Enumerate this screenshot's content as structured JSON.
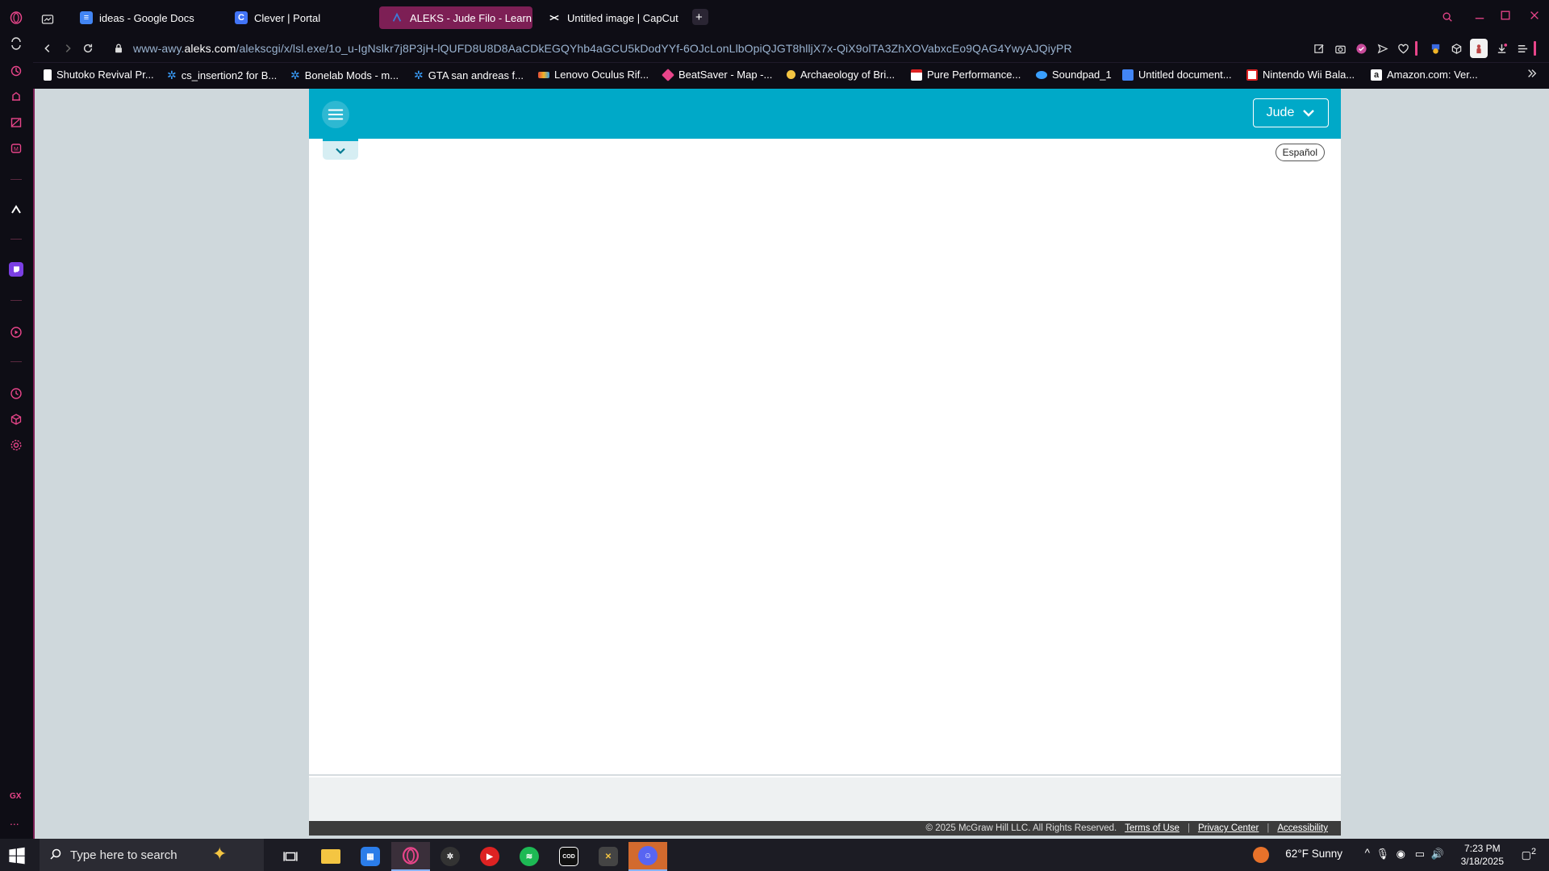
{
  "browser": {
    "tabs": [
      {
        "title": "ideas - Google Docs",
        "icon": "google-docs-icon",
        "color": "#4285f4",
        "active": false
      },
      {
        "title": "Clever | Portal",
        "icon": "clever-icon",
        "color": "#4274f6",
        "active": false
      },
      {
        "title": "ALEKS - Jude Filo - Learn",
        "icon": "aleks-icon",
        "color": "#8c2b6c",
        "active": true
      },
      {
        "title": "Untitled image | CapCut",
        "icon": "capcut-icon",
        "color": "#ffffff",
        "active": false
      }
    ],
    "new_tab": "+",
    "url_prefix": "www-awy.",
    "url_host": "aleks.com",
    "url_path": "/alekscgi/x/lsl.exe/1o_u-IgNslkr7j8P3jH-lQUFD8U8D8AaCDkEGQYhb4aGCU5kDodYYf-6OJcLonLlbOpiQJGT8hlljX7x-QiX9olTA3ZhXOVabxcEo9QAG4YwyAJQiyPR",
    "bookmarks": [
      {
        "label": "Shutoko Revival Pr...",
        "color": "#ffffff"
      },
      {
        "label": "cs_insertion2 for B...",
        "color": "#3aa0ff"
      },
      {
        "label": "Bonelab Mods - m...",
        "color": "#3aa0ff"
      },
      {
        "label": "GTA san andreas f...",
        "color": "#3aa0ff"
      },
      {
        "label": "Lenovo Oculus Rif...",
        "color": "#e04b3a"
      },
      {
        "label": "BeatSaver - Map -...",
        "color": "#e8458a"
      },
      {
        "label": "Archaeology of Bri...",
        "color": "#f4c542"
      },
      {
        "label": "Pure Performance...",
        "color": "#d22"
      },
      {
        "label": "Soundpad_1",
        "color": "#3aa0ff"
      },
      {
        "label": "Untitled document...",
        "color": "#4285f4"
      },
      {
        "label": "Nintendo Wii Bala...",
        "color": "#d22"
      },
      {
        "label": "Amazon.com: Ver...",
        "color": "#222"
      }
    ],
    "accent": "#e8458a"
  },
  "aleks": {
    "user_name": "Jude",
    "language_button": "Español",
    "header_color": "#00a9c8",
    "footer": {
      "copyright": "© 2025 McGraw Hill LLC. All Rights Reserved.",
      "terms": "Terms of Use",
      "privacy": "Privacy Center",
      "accessibility": "Accessibility",
      "separator": "|"
    }
  },
  "taskbar": {
    "search_placeholder": "Type here to search",
    "weather": "62°F  Sunny",
    "time": "7:23 PM",
    "date": "3/18/2025",
    "notification_count": "2"
  },
  "gx": {
    "label": "GX",
    "more": "..."
  }
}
